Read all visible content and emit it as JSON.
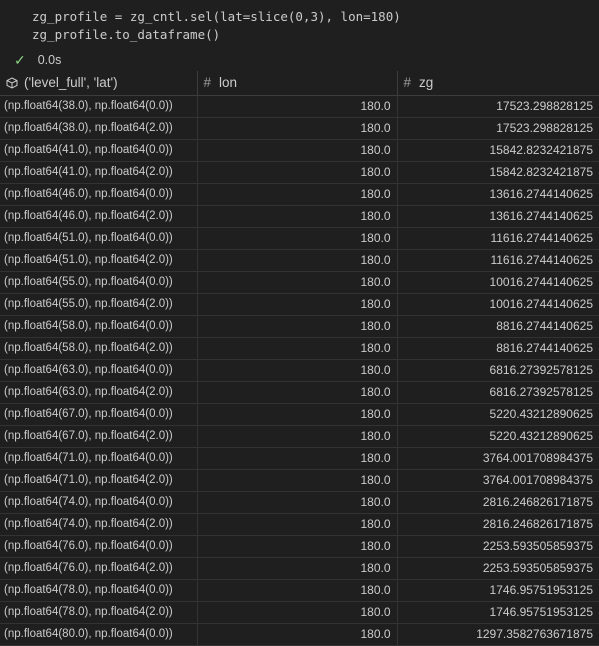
{
  "code": {
    "line1": "zg_profile = zg_cntl.sel(lat=slice(0,3), lon=180)",
    "line2": "zg_profile.to_dataframe()"
  },
  "status": {
    "time": "0.0s",
    "icon": "check-icon"
  },
  "table": {
    "columns": [
      {
        "label": "('level_full', 'lat')",
        "icon": "cube-icon"
      },
      {
        "label": "lon",
        "icon": "hash-icon"
      },
      {
        "label": "zg",
        "icon": "hash-icon"
      }
    ],
    "rows": [
      [
        "(np.float64(38.0), np.float64(0.0))",
        "180.0",
        "17523.298828125"
      ],
      [
        "(np.float64(38.0), np.float64(2.0))",
        "180.0",
        "17523.298828125"
      ],
      [
        "(np.float64(41.0), np.float64(0.0))",
        "180.0",
        "15842.8232421875"
      ],
      [
        "(np.float64(41.0), np.float64(2.0))",
        "180.0",
        "15842.8232421875"
      ],
      [
        "(np.float64(46.0), np.float64(0.0))",
        "180.0",
        "13616.2744140625"
      ],
      [
        "(np.float64(46.0), np.float64(2.0))",
        "180.0",
        "13616.2744140625"
      ],
      [
        "(np.float64(51.0), np.float64(0.0))",
        "180.0",
        "11616.2744140625"
      ],
      [
        "(np.float64(51.0), np.float64(2.0))",
        "180.0",
        "11616.2744140625"
      ],
      [
        "(np.float64(55.0), np.float64(0.0))",
        "180.0",
        "10016.2744140625"
      ],
      [
        "(np.float64(55.0), np.float64(2.0))",
        "180.0",
        "10016.2744140625"
      ],
      [
        "(np.float64(58.0), np.float64(0.0))",
        "180.0",
        "8816.2744140625"
      ],
      [
        "(np.float64(58.0), np.float64(2.0))",
        "180.0",
        "8816.2744140625"
      ],
      [
        "(np.float64(63.0), np.float64(0.0))",
        "180.0",
        "6816.27392578125"
      ],
      [
        "(np.float64(63.0), np.float64(2.0))",
        "180.0",
        "6816.27392578125"
      ],
      [
        "(np.float64(67.0), np.float64(0.0))",
        "180.0",
        "5220.43212890625"
      ],
      [
        "(np.float64(67.0), np.float64(2.0))",
        "180.0",
        "5220.43212890625"
      ],
      [
        "(np.float64(71.0), np.float64(0.0))",
        "180.0",
        "3764.001708984375"
      ],
      [
        "(np.float64(71.0), np.float64(2.0))",
        "180.0",
        "3764.001708984375"
      ],
      [
        "(np.float64(74.0), np.float64(0.0))",
        "180.0",
        "2816.246826171875"
      ],
      [
        "(np.float64(74.0), np.float64(2.0))",
        "180.0",
        "2816.246826171875"
      ],
      [
        "(np.float64(76.0), np.float64(0.0))",
        "180.0",
        "2253.593505859375"
      ],
      [
        "(np.float64(76.0), np.float64(2.0))",
        "180.0",
        "2253.593505859375"
      ],
      [
        "(np.float64(78.0), np.float64(0.0))",
        "180.0",
        "1746.95751953125"
      ],
      [
        "(np.float64(78.0), np.float64(2.0))",
        "180.0",
        "1746.95751953125"
      ],
      [
        "(np.float64(80.0), np.float64(0.0))",
        "180.0",
        "1297.3582763671875"
      ]
    ]
  }
}
